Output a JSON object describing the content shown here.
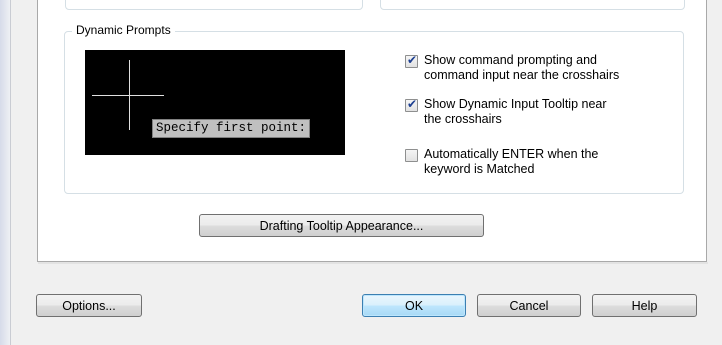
{
  "group": {
    "title": "Dynamic Prompts"
  },
  "preview": {
    "tooltip_text": "Specify first point:"
  },
  "checkboxes": [
    {
      "line1": "Show command prompting and",
      "line2": "command input near the crosshairs",
      "checked": true
    },
    {
      "line1": "Show Dynamic Input Tooltip near",
      "line2": "the crosshairs",
      "checked": true
    },
    {
      "line1": "Automatically ENTER when the",
      "line2": "keyword is Matched",
      "checked": false
    }
  ],
  "buttons": {
    "tooltip_appearance": "Drafting Tooltip Appearance...",
    "options": "Options...",
    "ok": "OK",
    "cancel": "Cancel",
    "help": "Help"
  }
}
